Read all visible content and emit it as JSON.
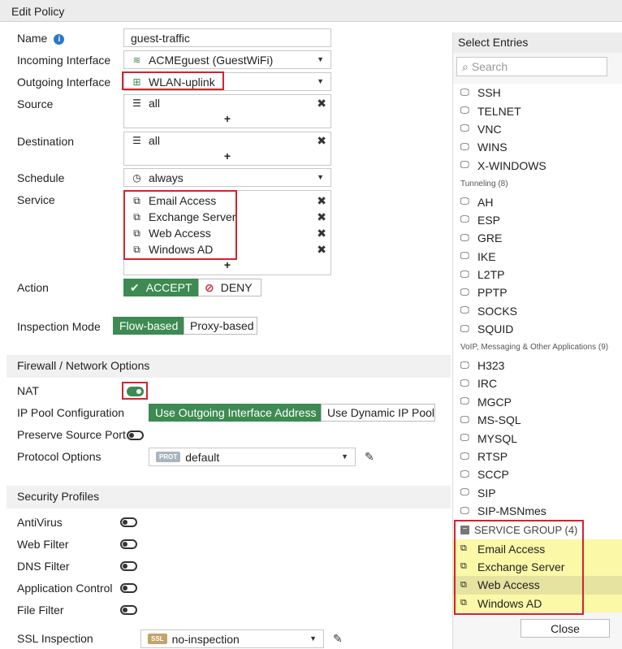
{
  "window": {
    "title": "Edit Policy"
  },
  "form": {
    "name": {
      "label": "Name",
      "value": "guest-traffic"
    },
    "incoming": {
      "label": "Incoming Interface",
      "value": "ACMEguest (GuestWiFi)"
    },
    "outgoing": {
      "label": "Outgoing Interface",
      "value": "WLAN-uplink"
    },
    "source": {
      "label": "Source",
      "items": [
        "all"
      ]
    },
    "destination": {
      "label": "Destination",
      "items": [
        "all"
      ]
    },
    "schedule": {
      "label": "Schedule",
      "value": "always"
    },
    "service": {
      "label": "Service",
      "items": [
        "Email Access",
        "Exchange Server",
        "Web Access",
        "Windows AD"
      ]
    },
    "action": {
      "label": "Action",
      "accept": "ACCEPT",
      "deny": "DENY",
      "selected": "ACCEPT"
    },
    "inspection": {
      "label": "Inspection Mode",
      "flow": "Flow-based",
      "proxy": "Proxy-based",
      "selected": "Flow-based"
    }
  },
  "firewall": {
    "heading": "Firewall / Network Options",
    "nat": {
      "label": "NAT",
      "on": true
    },
    "ippool": {
      "label": "IP Pool Configuration",
      "outgoing": "Use Outgoing Interface Address",
      "dynamic": "Use Dynamic IP Pool",
      "selected": "Use Outgoing Interface Address"
    },
    "preserve": {
      "label": "Preserve Source Port",
      "on": false
    },
    "protocol": {
      "label": "Protocol Options",
      "badge": "PROT",
      "value": "default"
    }
  },
  "security": {
    "heading": "Security Profiles",
    "profiles": [
      {
        "label": "AntiVirus",
        "on": false
      },
      {
        "label": "Web Filter",
        "on": false
      },
      {
        "label": "DNS Filter",
        "on": false
      },
      {
        "label": "Application Control",
        "on": false
      },
      {
        "label": "File Filter",
        "on": false
      }
    ],
    "ssl": {
      "label": "SSL Inspection",
      "badge": "SSL",
      "value": "no-inspection"
    }
  },
  "panel": {
    "title": "Select Entries",
    "search_placeholder": "Search",
    "group1": [
      "SSH",
      "TELNET",
      "VNC",
      "WINS",
      "X-WINDOWS"
    ],
    "cat_tunneling": "Tunneling (8)",
    "group2": [
      "AH",
      "ESP",
      "GRE",
      "IKE",
      "L2TP",
      "PPTP",
      "SOCKS",
      "SQUID"
    ],
    "cat_voip": "VoIP, Messaging & Other Applications (9)",
    "group3": [
      "H323",
      "IRC",
      "MGCP",
      "MS-SQL",
      "MYSQL",
      "RTSP",
      "SCCP",
      "SIP",
      "SIP-MSNmes"
    ],
    "service_group": "SERVICE GROUP (4)",
    "group4": [
      "Email Access",
      "Exchange Server",
      "Web Access",
      "Windows AD"
    ],
    "close": "Close"
  },
  "colors": {
    "accent": "#3d8a52",
    "highlight": "#d3242e",
    "selected_entry": "#fbf8a8"
  },
  "icons": {
    "info": "info-icon",
    "wifi": "wifi-icon",
    "interface": "interface-icon",
    "address": "address-icon",
    "schedule": "clock-icon",
    "service": "service-icon",
    "remove": "close-icon",
    "add": "plus-icon",
    "accept": "check-icon",
    "deny": "deny-icon",
    "edit": "pencil-icon",
    "search": "search-icon",
    "monitor": "monitor-icon"
  }
}
